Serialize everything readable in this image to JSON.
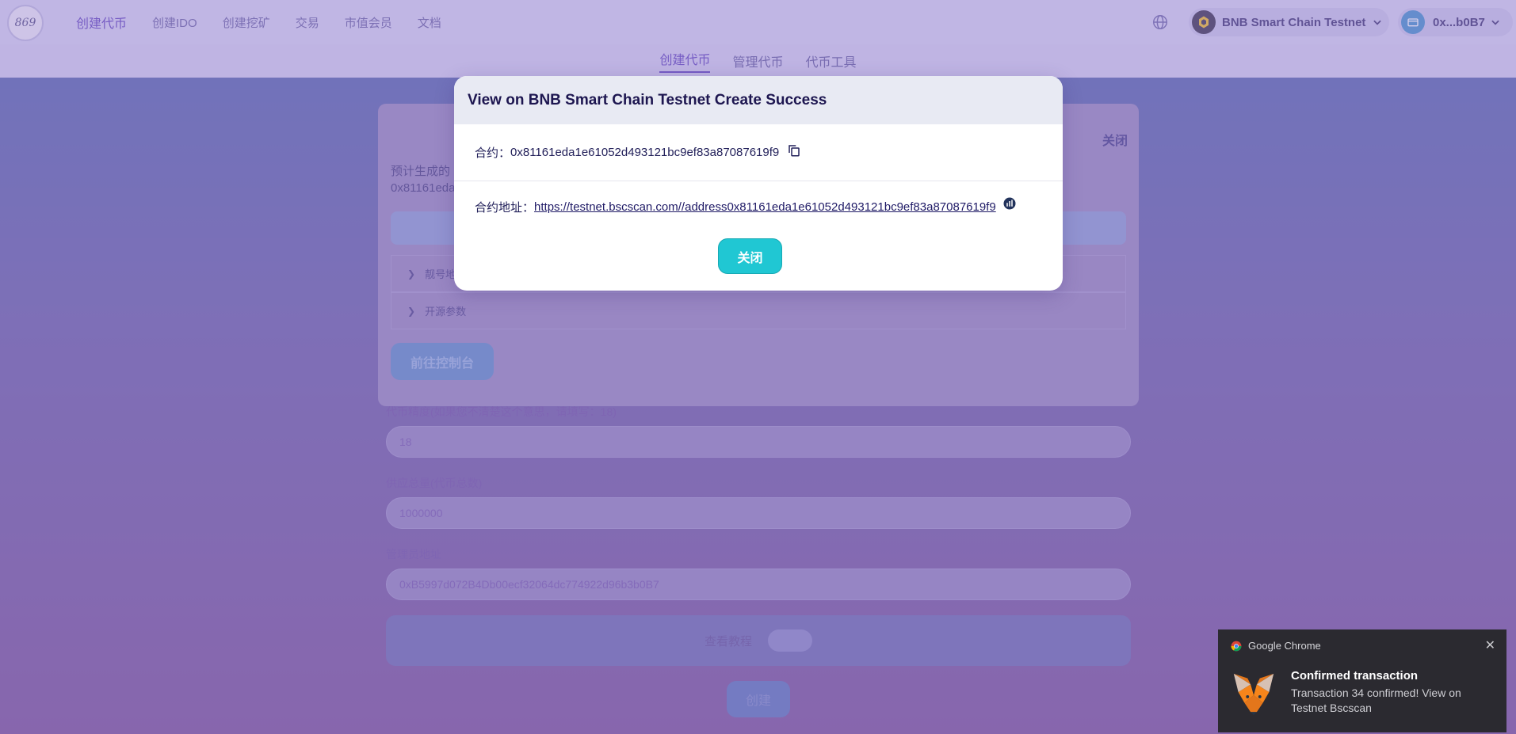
{
  "nav": {
    "logo_text": "869",
    "items": [
      "创建代币",
      "创建IDO",
      "创建挖矿",
      "交易",
      "市值会员",
      "文档"
    ],
    "chain_label": "BNB Smart Chain Testnet",
    "wallet_label": "0x...b0B7"
  },
  "subnav": {
    "items": [
      "创建代币",
      "管理代币",
      "代币工具"
    ]
  },
  "card": {
    "close_label": "关闭",
    "predicted_label": "预计生成的",
    "predicted_addr": "0x81161eda",
    "section_vanity": "靓号地",
    "section_opensource": "开源参数",
    "console_button": "前往控制台"
  },
  "form": {
    "decimals_label": "代币精度(如果您不清楚这个意思，请填写：18)",
    "decimals_value": "18",
    "supply_label": "供应总量(代币总数)",
    "supply_value": "1000000",
    "admin_label": "管理员地址",
    "admin_value": "0xB5997d072B4Db00ecf32064dc774922d96b3b0B7",
    "tutorial_label": "查看教程",
    "create_button": "创建"
  },
  "modal": {
    "title": "View on BNB Smart Chain Testnet Create Success",
    "contract_label": "合约：",
    "contract_value": "0x81161eda1e61052d493121bc9ef83a87087619f9",
    "address_label": "合约地址：",
    "address_link": "https://testnet.bscscan.com//address0x81161eda1e61052d493121bc9ef83a87087619f9",
    "close_button": "关闭"
  },
  "notification": {
    "app": "Google Chrome",
    "title": "Confirmed transaction",
    "body": "Transaction 34 confirmed! View on Testnet Bscscan"
  },
  "colors": {
    "accent": "#20c7d3",
    "nav_active": "#4c2db8",
    "modal_bg": "#ffffff"
  }
}
